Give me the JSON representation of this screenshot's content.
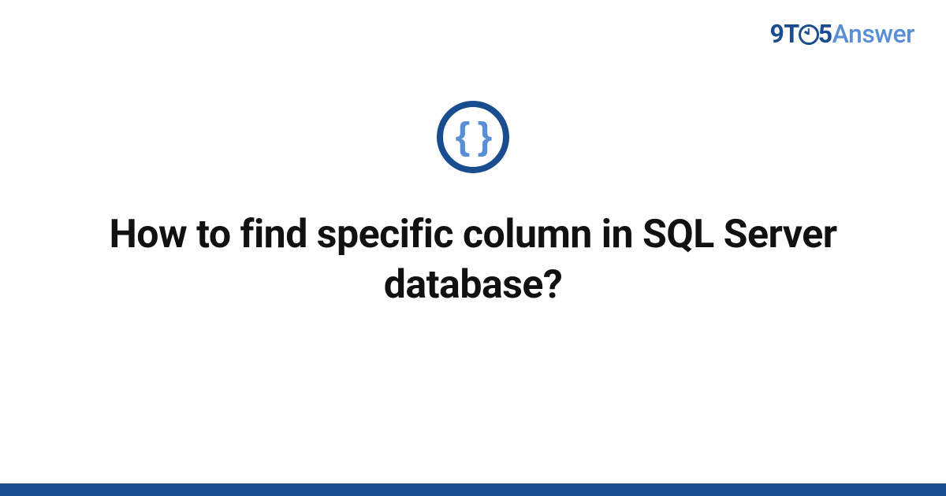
{
  "brand": {
    "part1": "9T",
    "part2": "5",
    "part3": "Answer"
  },
  "category_icon": {
    "symbol": "{ }",
    "name": "code-braces"
  },
  "question": {
    "title": "How to find specific column in SQL Server database?"
  },
  "colors": {
    "primary_dark": "#1a4d8f",
    "primary_light": "#5a8fd6"
  }
}
